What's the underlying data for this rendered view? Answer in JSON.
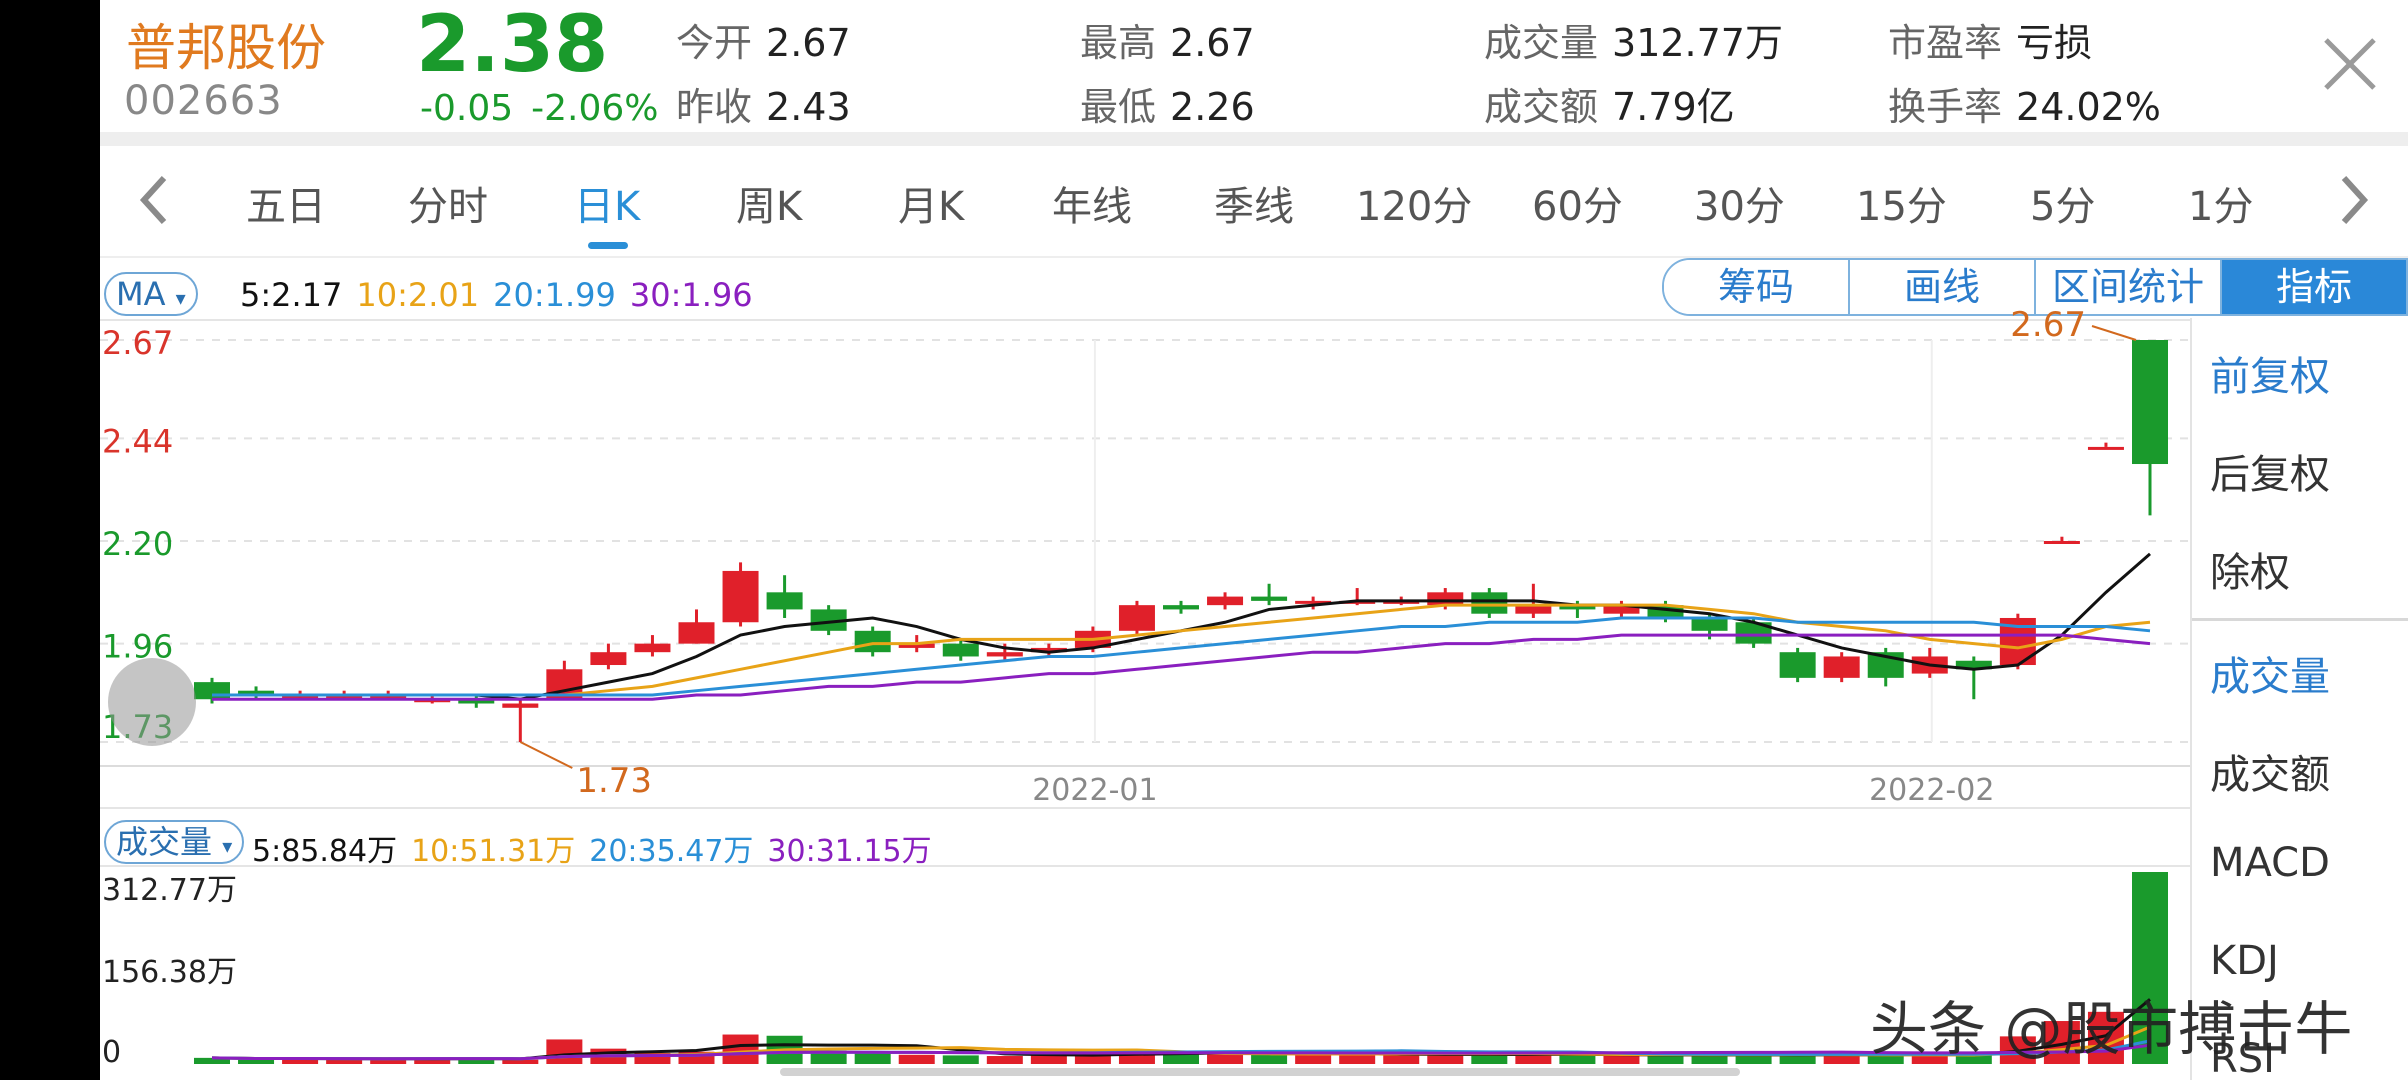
{
  "stock": {
    "name": "普邦股份",
    "code": "002663",
    "price": "2.38",
    "change": "-0.05",
    "change_pct": "-2.06%"
  },
  "quote": {
    "open_label": "今开",
    "open": "2.67",
    "prev_close_label": "昨收",
    "prev_close": "2.43",
    "high_label": "最高",
    "high": "2.67",
    "low_label": "最低",
    "low": "2.26",
    "volume_label": "成交量",
    "volume": "312.77万",
    "amount_label": "成交额",
    "amount": "7.79亿",
    "pe_label": "市盈率",
    "pe": "亏损",
    "turnover_label": "换手率",
    "turnover": "24.02%"
  },
  "tabs": [
    "五日",
    "分时",
    "日K",
    "周K",
    "月K",
    "年线",
    "季线",
    "120分",
    "60分",
    "30分",
    "15分",
    "5分",
    "1分"
  ],
  "active_tab": "日K",
  "ma_indicator": {
    "label": "MA",
    "ma5": "5:2.17",
    "ma10": "10:2.01",
    "ma20": "20:1.99",
    "ma30": "30:1.96"
  },
  "tools": [
    "筹码",
    "画线",
    "区间统计",
    "指标"
  ],
  "active_tool": "指标",
  "side_menu": {
    "adjust": [
      "前复权",
      "后复权",
      "除权"
    ],
    "indicators": [
      "成交量",
      "成交额",
      "MACD",
      "KDJ",
      "RSI"
    ],
    "selected_adjust": "前复权",
    "selected_indicator": "成交量"
  },
  "volume_indicator": {
    "label": "成交量",
    "ma5": "5:85.84万",
    "ma10": "10:51.31万",
    "ma20": "20:35.47万",
    "ma30": "30:31.15万"
  },
  "watermark": "头条 @股市搏击牛",
  "colors": {
    "up": "#e0202a",
    "down": "#1a9a2c",
    "accent": "#2a88d8",
    "ma5": "#111111",
    "ma10": "#e8a317",
    "ma20": "#2a8fd7",
    "ma30": "#8a1fbf",
    "name": "#e07a1f"
  },
  "icons": {
    "close": "close-icon",
    "prev": "chevron-left-icon",
    "next": "chevron-right-icon",
    "handle": "drag-handle-icon"
  },
  "chart_data": {
    "type": "candlestick",
    "price_axis": {
      "ticks": [
        "2.67",
        "2.44",
        "2.20",
        "1.96",
        "1.73"
      ],
      "ylim": [
        1.73,
        2.67
      ]
    },
    "x_labels": [
      "2022-01",
      "2022-02"
    ],
    "annotations": {
      "max": "2.67",
      "min": "1.73"
    },
    "candles": [
      {
        "o": 1.87,
        "c": 1.83,
        "h": 1.88,
        "l": 1.82
      },
      {
        "o": 1.85,
        "c": 1.84,
        "h": 1.86,
        "l": 1.83
      },
      {
        "o": 1.84,
        "c": 1.84,
        "h": 1.85,
        "l": 1.83
      },
      {
        "o": 1.84,
        "c": 1.84,
        "h": 1.85,
        "l": 1.83
      },
      {
        "o": 1.84,
        "c": 1.84,
        "h": 1.85,
        "l": 1.83
      },
      {
        "o": 1.83,
        "c": 1.83,
        "h": 1.84,
        "l": 1.82
      },
      {
        "o": 1.83,
        "c": 1.82,
        "h": 1.84,
        "l": 1.81
      },
      {
        "o": 1.81,
        "c": 1.82,
        "h": 1.83,
        "l": 1.73
      },
      {
        "o": 1.83,
        "c": 1.9,
        "h": 1.92,
        "l": 1.83
      },
      {
        "o": 1.91,
        "c": 1.94,
        "h": 1.96,
        "l": 1.9
      },
      {
        "o": 1.94,
        "c": 1.96,
        "h": 1.98,
        "l": 1.93
      },
      {
        "o": 1.96,
        "c": 2.01,
        "h": 2.04,
        "l": 1.96
      },
      {
        "o": 2.01,
        "c": 2.13,
        "h": 2.15,
        "l": 2.0
      },
      {
        "o": 2.08,
        "c": 2.04,
        "h": 2.12,
        "l": 2.02
      },
      {
        "o": 2.04,
        "c": 1.99,
        "h": 2.05,
        "l": 1.98
      },
      {
        "o": 1.99,
        "c": 1.94,
        "h": 2.0,
        "l": 1.93
      },
      {
        "o": 1.95,
        "c": 1.96,
        "h": 1.98,
        "l": 1.94
      },
      {
        "o": 1.96,
        "c": 1.93,
        "h": 1.97,
        "l": 1.92
      },
      {
        "o": 1.93,
        "c": 1.94,
        "h": 1.96,
        "l": 1.92
      },
      {
        "o": 1.94,
        "c": 1.95,
        "h": 1.96,
        "l": 1.93
      },
      {
        "o": 1.95,
        "c": 1.99,
        "h": 2.0,
        "l": 1.94
      },
      {
        "o": 1.99,
        "c": 2.05,
        "h": 2.06,
        "l": 1.98
      },
      {
        "o": 2.05,
        "c": 2.04,
        "h": 2.06,
        "l": 2.03
      },
      {
        "o": 2.05,
        "c": 2.07,
        "h": 2.08,
        "l": 2.04
      },
      {
        "o": 2.07,
        "c": 2.06,
        "h": 2.1,
        "l": 2.05
      },
      {
        "o": 2.06,
        "c": 2.06,
        "h": 2.07,
        "l": 2.04
      },
      {
        "o": 2.06,
        "c": 2.06,
        "h": 2.09,
        "l": 2.05
      },
      {
        "o": 2.06,
        "c": 2.06,
        "h": 2.07,
        "l": 2.05
      },
      {
        "o": 2.05,
        "c": 2.08,
        "h": 2.09,
        "l": 2.04
      },
      {
        "o": 2.08,
        "c": 2.03,
        "h": 2.09,
        "l": 2.02
      },
      {
        "o": 2.03,
        "c": 2.05,
        "h": 2.1,
        "l": 2.02
      },
      {
        "o": 2.05,
        "c": 2.04,
        "h": 2.06,
        "l": 2.02
      },
      {
        "o": 2.03,
        "c": 2.05,
        "h": 2.06,
        "l": 2.02
      },
      {
        "o": 2.05,
        "c": 2.02,
        "h": 2.06,
        "l": 2.01
      },
      {
        "o": 2.02,
        "c": 1.99,
        "h": 2.03,
        "l": 1.97
      },
      {
        "o": 2.01,
        "c": 1.96,
        "h": 2.02,
        "l": 1.95
      },
      {
        "o": 1.94,
        "c": 1.88,
        "h": 1.95,
        "l": 1.87
      },
      {
        "o": 1.88,
        "c": 1.93,
        "h": 1.94,
        "l": 1.87
      },
      {
        "o": 1.94,
        "c": 1.88,
        "h": 1.95,
        "l": 1.86
      },
      {
        "o": 1.89,
        "c": 1.93,
        "h": 1.95,
        "l": 1.88
      },
      {
        "o": 1.92,
        "c": 1.9,
        "h": 1.93,
        "l": 1.83
      },
      {
        "o": 1.91,
        "c": 2.02,
        "h": 2.03,
        "l": 1.9
      },
      {
        "o": 2.2,
        "c": 2.2,
        "h": 2.21,
        "l": 2.2
      },
      {
        "o": 2.42,
        "c": 2.42,
        "h": 2.43,
        "l": 2.42
      },
      {
        "o": 2.67,
        "c": 2.38,
        "h": 2.67,
        "l": 2.26
      }
    ],
    "ma_series": [
      {
        "name": "MA5",
        "values": [
          1.84,
          1.84,
          1.84,
          1.84,
          1.84,
          1.84,
          1.84,
          1.83,
          1.85,
          1.87,
          1.89,
          1.93,
          1.98,
          2.0,
          2.01,
          2.02,
          2.0,
          1.97,
          1.95,
          1.94,
          1.95,
          1.97,
          1.99,
          2.01,
          2.04,
          2.05,
          2.06,
          2.06,
          2.06,
          2.06,
          2.06,
          2.05,
          2.05,
          2.04,
          2.03,
          2.01,
          1.98,
          1.95,
          1.93,
          1.91,
          1.9,
          1.91,
          1.98,
          2.08,
          2.17
        ]
      },
      {
        "name": "MA10",
        "values": [
          1.84,
          1.84,
          1.84,
          1.84,
          1.84,
          1.84,
          1.84,
          1.84,
          1.84,
          1.85,
          1.86,
          1.88,
          1.9,
          1.92,
          1.94,
          1.96,
          1.96,
          1.97,
          1.97,
          1.97,
          1.97,
          1.98,
          1.99,
          2.0,
          2.01,
          2.02,
          2.03,
          2.04,
          2.05,
          2.05,
          2.05,
          2.05,
          2.05,
          2.05,
          2.04,
          2.03,
          2.01,
          2.0,
          1.99,
          1.97,
          1.96,
          1.95,
          1.97,
          2.0,
          2.01
        ]
      },
      {
        "name": "MA20",
        "values": [
          1.84,
          1.84,
          1.84,
          1.84,
          1.84,
          1.84,
          1.84,
          1.84,
          1.84,
          1.84,
          1.84,
          1.85,
          1.86,
          1.87,
          1.88,
          1.89,
          1.9,
          1.91,
          1.92,
          1.93,
          1.93,
          1.94,
          1.95,
          1.96,
          1.97,
          1.98,
          1.99,
          2.0,
          2.0,
          2.01,
          2.01,
          2.01,
          2.02,
          2.02,
          2.02,
          2.02,
          2.01,
          2.01,
          2.01,
          2.01,
          2.01,
          2.0,
          2.0,
          2.0,
          1.99
        ]
      },
      {
        "name": "MA30",
        "values": [
          1.83,
          1.83,
          1.83,
          1.83,
          1.83,
          1.83,
          1.83,
          1.83,
          1.83,
          1.83,
          1.83,
          1.84,
          1.84,
          1.85,
          1.86,
          1.86,
          1.87,
          1.87,
          1.88,
          1.89,
          1.89,
          1.9,
          1.91,
          1.92,
          1.93,
          1.94,
          1.94,
          1.95,
          1.96,
          1.96,
          1.97,
          1.97,
          1.98,
          1.98,
          1.98,
          1.98,
          1.98,
          1.98,
          1.98,
          1.98,
          1.98,
          1.98,
          1.98,
          1.97,
          1.96
        ]
      }
    ],
    "volume_axis": {
      "ticks": [
        "312.77万",
        "156.38万",
        "0"
      ],
      "ylim": [
        0,
        312.77
      ]
    },
    "volume": [
      10,
      8,
      9,
      8,
      8,
      9,
      10,
      7,
      40,
      25,
      18,
      20,
      48,
      46,
      22,
      18,
      15,
      14,
      13,
      16,
      14,
      22,
      20,
      18,
      16,
      15,
      14,
      16,
      17,
      15,
      16,
      14,
      14,
      15,
      14,
      16,
      15,
      14,
      15,
      16,
      14,
      45,
      70,
      85,
      312.77
    ]
  }
}
